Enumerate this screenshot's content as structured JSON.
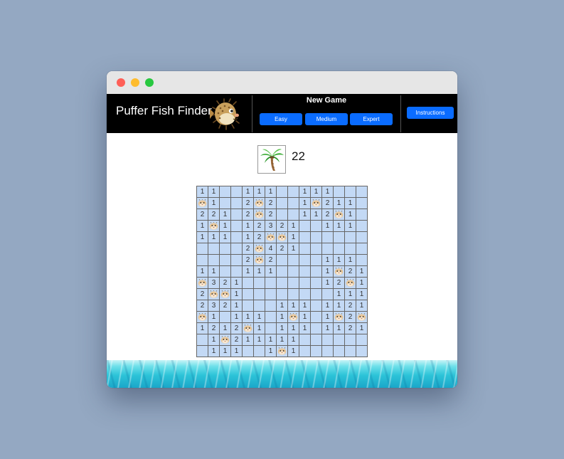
{
  "header": {
    "title": "Puffer Fish Finder",
    "new_game_label": "New Game",
    "buttons": {
      "easy": "Easy",
      "medium": "Medium",
      "expert": "Expert",
      "instructions": "Instructions"
    }
  },
  "status": {
    "remaining": "22",
    "flag_icon": "palm-tree-icon"
  },
  "board": {
    "rows": [
      [
        "1",
        "1",
        "",
        "",
        "1",
        "1",
        "1",
        "",
        "",
        "1",
        "1",
        "1",
        "",
        "",
        ""
      ],
      [
        "F",
        "1",
        "",
        "",
        "2",
        "F",
        "2",
        "",
        "",
        "1",
        "F",
        "2",
        "1",
        "1",
        ""
      ],
      [
        "2",
        "2",
        "1",
        "",
        "2",
        "F",
        "2",
        "",
        "",
        "1",
        "1",
        "2",
        "F",
        "1",
        ""
      ],
      [
        "1",
        "F",
        "1",
        "",
        "1",
        "2",
        "3",
        "2",
        "1",
        "",
        "",
        "1",
        "1",
        "1",
        ""
      ],
      [
        "1",
        "1",
        "1",
        "",
        "1",
        "2",
        "F",
        "F",
        "1",
        "",
        "",
        "",
        "",
        "",
        ""
      ],
      [
        "",
        "",
        "",
        "",
        "2",
        "F",
        "4",
        "2",
        "1",
        "",
        "",
        "",
        "",
        "",
        ""
      ],
      [
        "",
        "",
        "",
        "",
        "2",
        "F",
        "2",
        "",
        "",
        "",
        "",
        "1",
        "1",
        "1",
        ""
      ],
      [
        "1",
        "1",
        "",
        "",
        "1",
        "1",
        "1",
        "",
        "",
        "",
        "",
        "1",
        "F",
        "2",
        "1"
      ],
      [
        "F",
        "3",
        "2",
        "1",
        "",
        "",
        "",
        "",
        "",
        "",
        "",
        "1",
        "2",
        "F",
        "1"
      ],
      [
        "2",
        "F",
        "F",
        "1",
        "",
        "",
        "",
        "",
        "",
        "",
        "",
        "",
        "1",
        "1",
        "1"
      ],
      [
        "2",
        "3",
        "2",
        "1",
        "",
        "",
        "",
        "1",
        "1",
        "1",
        "",
        "1",
        "1",
        "2",
        "1"
      ],
      [
        "F",
        "1",
        "",
        "1",
        "1",
        "1",
        "",
        "1",
        "F",
        "1",
        "",
        "1",
        "F",
        "2",
        "F"
      ],
      [
        "1",
        "2",
        "1",
        "2",
        "F",
        "1",
        "",
        "1",
        "1",
        "1",
        "",
        "1",
        "1",
        "2",
        "1"
      ],
      [
        "",
        "1",
        "F",
        "2",
        "1",
        "1",
        "1",
        "1",
        "1",
        "",
        "",
        "",
        "",
        "",
        ""
      ],
      [
        "",
        "1",
        "1",
        "1",
        "",
        "",
        "1",
        "F",
        "1",
        "",
        "",
        "",
        "",
        "",
        ""
      ]
    ]
  },
  "colors": {
    "button": "#0a6cff",
    "cell": "#c3d9f5",
    "header": "#000000"
  }
}
